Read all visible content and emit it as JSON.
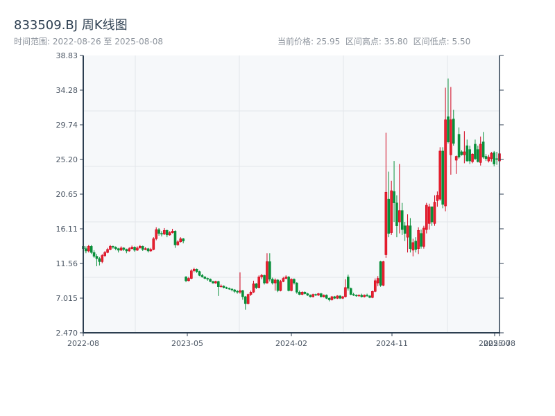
{
  "header": {
    "title": "833509.BJ 周K线图",
    "range_text": "时间范围: 2022-08-26 至 2025-08-08",
    "stats_text": "当前价格: 25.95  区间高点: 35.80  区间低点: 5.50"
  },
  "chart_data": {
    "type": "candlestick",
    "title": "833509.BJ 周K线图",
    "period": "weekly",
    "date_range": [
      "2022-08-26",
      "2025-08-08"
    ],
    "current_price": 25.95,
    "range_high": 35.8,
    "range_low": 5.5,
    "ylim": [
      2.47,
      38.83
    ],
    "y_ticks": [
      "2.470",
      "7.015",
      "11.56",
      "16.11",
      "20.65",
      "25.20",
      "29.74",
      "34.28",
      "38.83"
    ],
    "x_ticks": [
      "2022-08",
      "2023-05",
      "2024-02",
      "2024-11",
      "2025-07",
      "2025-08"
    ],
    "grid": true,
    "colors": {
      "up": "#d0021b",
      "down": "#098f3a",
      "background": "#f6f8fa",
      "axis": "#2c3e50",
      "grid": "#e3e6ea"
    },
    "ohlc_columns": [
      "open",
      "high",
      "low",
      "close"
    ],
    "candles": [
      [
        13.8,
        14.0,
        13.2,
        13.5
      ],
      [
        13.5,
        13.8,
        12.9,
        13.2
      ],
      [
        13.2,
        14.0,
        13.0,
        13.8
      ],
      [
        13.8,
        14.0,
        12.8,
        13.0
      ],
      [
        13.0,
        13.3,
        12.3,
        12.5
      ],
      [
        12.5,
        12.8,
        11.2,
        12.2
      ],
      [
        12.2,
        12.4,
        11.3,
        11.8
      ],
      [
        11.8,
        12.8,
        11.6,
        12.6
      ],
      [
        12.6,
        13.2,
        12.4,
        13.0
      ],
      [
        13.0,
        13.6,
        12.9,
        13.4
      ],
      [
        13.4,
        14.0,
        13.3,
        13.8
      ],
      [
        13.8,
        13.9,
        13.5,
        13.7
      ],
      [
        13.7,
        13.8,
        13.3,
        13.5
      ],
      [
        13.5,
        13.6,
        13.0,
        13.3
      ],
      [
        13.3,
        13.8,
        13.2,
        13.6
      ],
      [
        13.6,
        13.7,
        13.2,
        13.4
      ],
      [
        13.4,
        13.5,
        12.9,
        13.2
      ],
      [
        13.2,
        13.7,
        13.1,
        13.5
      ],
      [
        13.5,
        13.9,
        13.4,
        13.7
      ],
      [
        13.7,
        13.8,
        13.1,
        13.3
      ],
      [
        13.3,
        13.8,
        13.2,
        13.6
      ],
      [
        13.6,
        14.0,
        13.5,
        13.8
      ],
      [
        13.8,
        13.9,
        13.2,
        13.4
      ],
      [
        13.4,
        13.7,
        13.3,
        13.5
      ],
      [
        13.5,
        13.6,
        13.0,
        13.2
      ],
      [
        13.2,
        13.6,
        13.1,
        13.4
      ],
      [
        13.4,
        15.0,
        13.3,
        14.8
      ],
      [
        14.8,
        16.3,
        14.6,
        16.0
      ],
      [
        16.0,
        16.2,
        15.2,
        15.5
      ],
      [
        15.5,
        15.8,
        15.1,
        15.4
      ],
      [
        15.4,
        16.2,
        15.3,
        15.9
      ],
      [
        15.9,
        16.0,
        15.0,
        15.3
      ],
      [
        15.3,
        15.8,
        15.2,
        15.6
      ],
      [
        15.6,
        16.1,
        15.5,
        15.8
      ],
      [
        15.8,
        15.9,
        13.6,
        14.0
      ],
      [
        14.0,
        14.6,
        13.9,
        14.4
      ],
      [
        14.4,
        15.0,
        14.3,
        14.8
      ],
      [
        14.8,
        14.9,
        14.2,
        14.5
      ],
      [
        9.8,
        9.9,
        9.1,
        9.3
      ],
      [
        9.3,
        9.8,
        9.2,
        9.6
      ],
      [
        9.6,
        10.8,
        9.5,
        10.6
      ],
      [
        10.6,
        11.0,
        10.4,
        10.8
      ],
      [
        10.8,
        10.9,
        10.3,
        10.5
      ],
      [
        10.5,
        10.6,
        9.9,
        10.0
      ],
      [
        10.0,
        10.2,
        9.7,
        9.8
      ],
      [
        9.8,
        9.9,
        9.5,
        9.6
      ],
      [
        9.6,
        9.7,
        9.3,
        9.5
      ],
      [
        9.5,
        9.6,
        9.1,
        9.2
      ],
      [
        9.2,
        9.3,
        8.9,
        9.0
      ],
      [
        9.0,
        9.3,
        8.9,
        9.2
      ],
      [
        9.2,
        9.3,
        7.3,
        8.5
      ],
      [
        8.5,
        8.8,
        8.4,
        8.6
      ],
      [
        8.6,
        8.7,
        8.3,
        8.4
      ],
      [
        8.4,
        8.5,
        8.2,
        8.3
      ],
      [
        8.3,
        8.4,
        8.1,
        8.2
      ],
      [
        8.2,
        8.3,
        7.9,
        8.1
      ],
      [
        8.1,
        8.2,
        7.7,
        7.9
      ],
      [
        7.9,
        8.1,
        7.6,
        7.8
      ],
      [
        7.8,
        10.4,
        7.6,
        8.0
      ],
      [
        8.0,
        8.1,
        6.8,
        7.2
      ],
      [
        7.2,
        7.3,
        5.5,
        6.3
      ],
      [
        6.3,
        7.6,
        6.2,
        7.5
      ],
      [
        7.5,
        8.0,
        7.3,
        7.8
      ],
      [
        7.8,
        9.3,
        7.7,
        8.9
      ],
      [
        8.9,
        9.0,
        8.2,
        8.4
      ],
      [
        8.4,
        10.0,
        8.3,
        9.8
      ],
      [
        9.8,
        10.2,
        9.5,
        10.0
      ],
      [
        10.0,
        10.1,
        8.8,
        9.0
      ],
      [
        9.0,
        12.9,
        8.9,
        11.8
      ],
      [
        11.8,
        12.9,
        9.2,
        9.5
      ],
      [
        9.5,
        9.7,
        8.8,
        9.0
      ],
      [
        9.0,
        9.6,
        8.0,
        9.4
      ],
      [
        9.4,
        9.5,
        7.8,
        8.0
      ],
      [
        8.0,
        9.4,
        7.9,
        9.2
      ],
      [
        9.2,
        9.8,
        9.1,
        9.6
      ],
      [
        9.6,
        10.0,
        9.5,
        9.8
      ],
      [
        9.8,
        9.9,
        7.9,
        8.0
      ],
      [
        8.0,
        9.6,
        7.9,
        9.5
      ],
      [
        9.5,
        9.6,
        8.8,
        9.0
      ],
      [
        9.0,
        9.1,
        7.6,
        7.8
      ],
      [
        7.8,
        8.0,
        7.4,
        7.5
      ],
      [
        7.5,
        7.9,
        7.4,
        7.8
      ],
      [
        7.8,
        7.9,
        7.5,
        7.6
      ],
      [
        7.6,
        7.7,
        7.3,
        7.4
      ],
      [
        7.4,
        7.5,
        7.1,
        7.2
      ],
      [
        7.2,
        7.6,
        7.1,
        7.5
      ],
      [
        7.5,
        7.6,
        7.3,
        7.4
      ],
      [
        7.4,
        7.7,
        7.3,
        7.6
      ],
      [
        7.6,
        7.7,
        7.1,
        7.2
      ],
      [
        7.2,
        7.5,
        7.1,
        7.4
      ],
      [
        7.4,
        7.5,
        6.9,
        7.0
      ],
      [
        7.0,
        7.1,
        6.6,
        6.8
      ],
      [
        6.8,
        7.3,
        6.7,
        7.2
      ],
      [
        7.2,
        7.3,
        6.9,
        7.0
      ],
      [
        7.0,
        7.4,
        6.9,
        7.3
      ],
      [
        7.3,
        7.4,
        6.9,
        7.0
      ],
      [
        7.0,
        7.3,
        6.9,
        7.2
      ],
      [
        7.2,
        9.5,
        7.1,
        8.4
      ],
      [
        9.8,
        10.1,
        8.0,
        8.3
      ],
      [
        8.3,
        8.4,
        7.4,
        7.5
      ],
      [
        7.5,
        7.7,
        7.3,
        7.4
      ],
      [
        7.4,
        7.5,
        7.2,
        7.3
      ],
      [
        7.3,
        7.5,
        7.2,
        7.4
      ],
      [
        7.4,
        7.6,
        7.1,
        7.2
      ],
      [
        7.2,
        7.5,
        7.1,
        7.4
      ],
      [
        7.4,
        7.6,
        7.2,
        7.3
      ],
      [
        7.3,
        7.4,
        7.0,
        7.1
      ],
      [
        7.1,
        8.0,
        7.0,
        7.9
      ],
      [
        7.9,
        9.6,
        7.8,
        9.3
      ],
      [
        9.0,
        9.9,
        8.6,
        9.6
      ],
      [
        11.8,
        11.9,
        8.5,
        8.7
      ],
      [
        8.7,
        11.9,
        8.6,
        11.8
      ],
      [
        12.7,
        28.7,
        12.3,
        20.9
      ],
      [
        20.0,
        23.6,
        15.0,
        15.5
      ],
      [
        15.6,
        22.4,
        15.3,
        21.1
      ],
      [
        21.0,
        25.0,
        17.0,
        19.5
      ],
      [
        19.5,
        20.5,
        15.0,
        16.5
      ],
      [
        17.0,
        24.6,
        15.5,
        18.5
      ],
      [
        18.5,
        19.5,
        15.3,
        16.0
      ],
      [
        16.5,
        17.0,
        14.5,
        15.5
      ],
      [
        15.0,
        18.0,
        13.0,
        16.5
      ],
      [
        16.5,
        17.5,
        13.0,
        13.5
      ],
      [
        13.3,
        14.8,
        12.5,
        14.3
      ],
      [
        14.5,
        15.0,
        13.0,
        13.4
      ],
      [
        13.5,
        16.3,
        12.8,
        15.9
      ],
      [
        15.5,
        16.0,
        13.5,
        13.8
      ],
      [
        13.8,
        16.5,
        13.5,
        16.2
      ],
      [
        16.0,
        19.5,
        15.5,
        19.2
      ],
      [
        16.8,
        19.4,
        16.0,
        19.0
      ],
      [
        19.0,
        19.0,
        16.5,
        17.0
      ],
      [
        16.8,
        20.5,
        16.5,
        19.6
      ],
      [
        19.8,
        21.0,
        19.0,
        20.5
      ],
      [
        20.0,
        26.8,
        19.8,
        26.3
      ],
      [
        26.3,
        26.8,
        18.8,
        19.3
      ],
      [
        19.1,
        34.6,
        18.4,
        30.4
      ],
      [
        30.8,
        35.8,
        27.3,
        27.5
      ],
      [
        25.8,
        34.7,
        23.2,
        30.4
      ],
      [
        30.5,
        31.7,
        27.0,
        27.3
      ],
      [
        25.1,
        25.7,
        23.3,
        25.6
      ],
      [
        28.5,
        29.4,
        25.3,
        25.5
      ],
      [
        26.2,
        26.4,
        25.7,
        25.8
      ],
      [
        25.8,
        28.9,
        24.7,
        26.2
      ],
      [
        27.0,
        27.8,
        24.9,
        25.0
      ],
      [
        26.5,
        27.0,
        24.6,
        25.0
      ],
      [
        24.9,
        26.0,
        24.7,
        25.9
      ],
      [
        27.2,
        27.8,
        25.1,
        25.3
      ],
      [
        26.5,
        27.0,
        24.8,
        24.9
      ],
      [
        24.8,
        28.2,
        24.4,
        27.2
      ],
      [
        27.5,
        28.8,
        25.3,
        25.5
      ],
      [
        25.6,
        25.9,
        25.0,
        25.3
      ],
      [
        25.0,
        25.8,
        24.8,
        25.5
      ],
      [
        25.3,
        26.2,
        24.9,
        26.0
      ],
      [
        26.1,
        26.3,
        24.3,
        24.6
      ],
      [
        25.3,
        26.2,
        24.5,
        25.2
      ],
      [
        25.0,
        27.5,
        24.3,
        25.95
      ]
    ]
  }
}
